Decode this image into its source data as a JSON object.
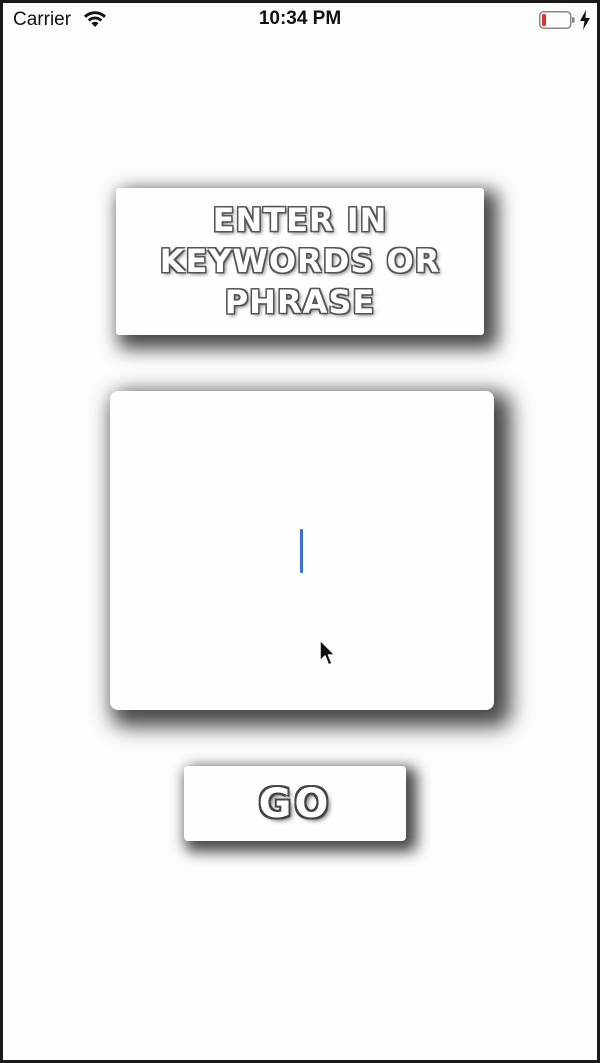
{
  "status_bar": {
    "carrier": "Carrier",
    "time": "10:34 PM",
    "wifi_icon": "wifi-icon",
    "battery_icon": "battery-low-icon",
    "charging_icon": "bolt-icon",
    "battery_level_fraction": 0.15
  },
  "prompt": {
    "line1": "ENTER IN",
    "line2": "KEYWORDS OR",
    "line3": "PHRASE"
  },
  "input": {
    "value": "",
    "placeholder": ""
  },
  "go_button": {
    "label": "GO"
  },
  "colors": {
    "background": "#fdfdfd",
    "card": "#fefefe",
    "caret": "#3d6fd6",
    "battery_low": "#e0302a"
  }
}
